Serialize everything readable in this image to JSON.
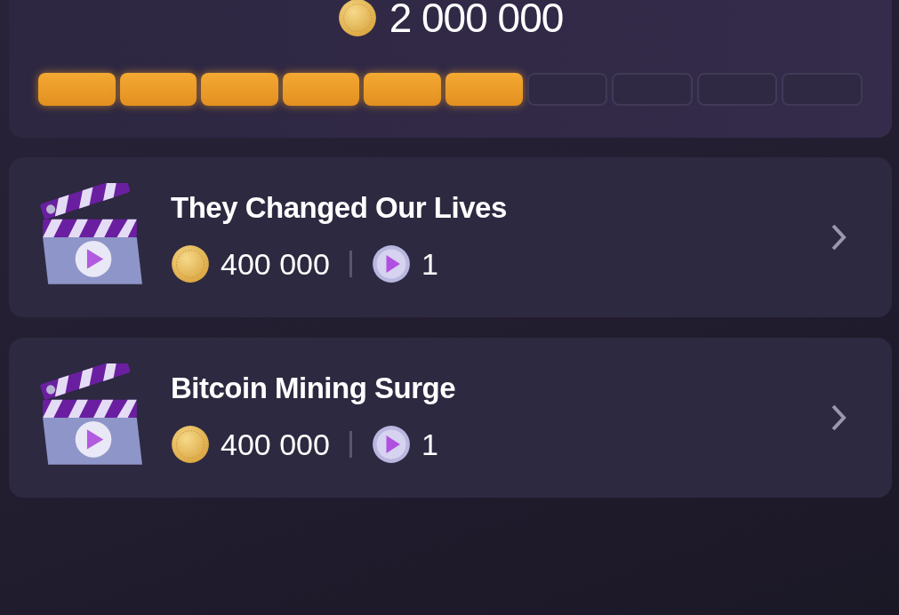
{
  "total": {
    "amount": "2 000 000"
  },
  "progress": {
    "segments": [
      {
        "filled": true
      },
      {
        "filled": true
      },
      {
        "filled": true
      },
      {
        "filled": true
      },
      {
        "filled": true
      },
      {
        "filled": true
      },
      {
        "filled": false
      },
      {
        "filled": false
      },
      {
        "filled": false
      },
      {
        "filled": false
      }
    ]
  },
  "items": [
    {
      "title": "They Changed Our Lives",
      "coins": "400 000",
      "videos": "1"
    },
    {
      "title": "Bitcoin Mining Surge",
      "coins": "400 000",
      "videos": "1"
    }
  ]
}
